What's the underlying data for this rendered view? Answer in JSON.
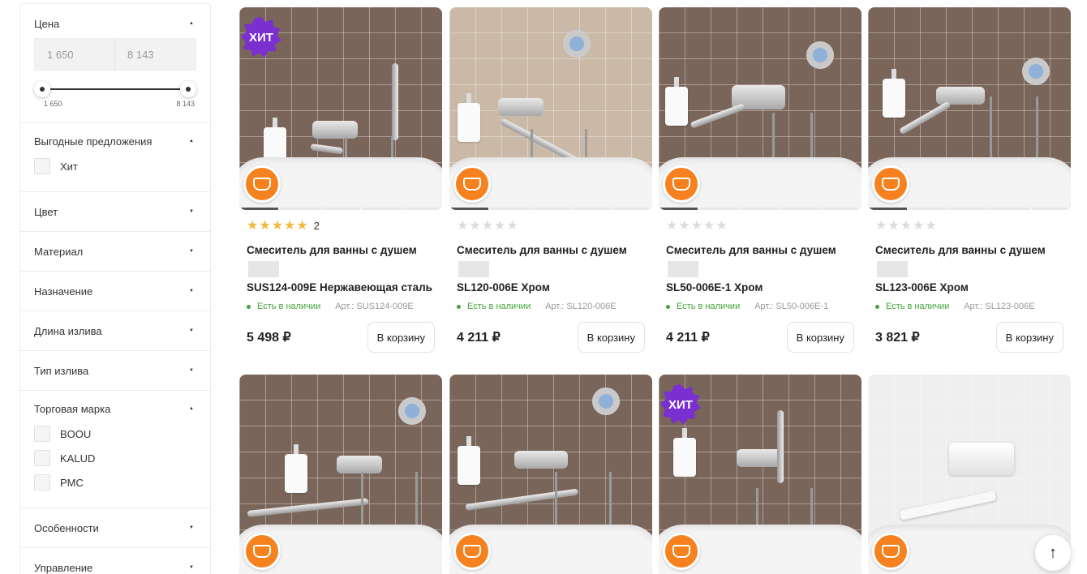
{
  "filters": {
    "price": {
      "label": "Цена",
      "min_value": "1 650",
      "max_value": "8 143",
      "slider_min_label": "1 650",
      "slider_max_label": "8 143",
      "expanded": true
    },
    "deals": {
      "label": "Выгодные предложения",
      "options": [
        "Хит"
      ],
      "expanded": true
    },
    "color": {
      "label": "Цвет"
    },
    "material": {
      "label": "Материал"
    },
    "purpose": {
      "label": "Назначение"
    },
    "spout_length": {
      "label": "Длина излива"
    },
    "spout_type": {
      "label": "Тип излива"
    },
    "brand": {
      "label": "Торговая марка",
      "options": [
        "BOOU",
        "KALUD",
        "PMC"
      ],
      "expanded": true
    },
    "features": {
      "label": "Особенности"
    },
    "control": {
      "label": "Управление"
    }
  },
  "products": [
    {
      "title_line1": "Смеситель для ванны с душем",
      "title_line2": "SUS124-009E Нержавеющая сталь",
      "stars": 5,
      "reviews": "2",
      "stock": "Есть в наличии",
      "article": "Арт.: SUS124-009E",
      "price": "5 498 ₽",
      "cart_label": "В корзину",
      "hit_badge": "ХИТ"
    },
    {
      "title_line1": "Смеситель для ванны с душем",
      "title_line2": "SL120-006E Хром",
      "stars": 0,
      "stock": "Есть в наличии",
      "article": "Арт.: SL120-006E",
      "price": "4 211 ₽",
      "cart_label": "В корзину"
    },
    {
      "title_line1": "Смеситель для ванны с душем",
      "title_line2": "SL50-006E-1 Хром",
      "stars": 0,
      "stock": "Есть в наличии",
      "article": "Арт.: SL50-006E-1",
      "price": "4 211 ₽",
      "cart_label": "В корзину"
    },
    {
      "title_line1": "Смеситель для ванны с душем",
      "title_line2": "SL123-006E Хром",
      "stars": 0,
      "stock": "Есть в наличии",
      "article": "Арт.: SL123-006E",
      "price": "3 821 ₽",
      "cart_label": "В корзину"
    },
    {
      "hit_badge": null
    },
    {
      "hit_badge": null
    },
    {
      "hit_badge": "ХИТ"
    },
    {
      "hit_badge": null
    }
  ],
  "stars": {
    "full": "★★★★★",
    "empty": "★★★★★"
  },
  "icons": {
    "chevron_up": "▲",
    "chevron_down": "▼",
    "scroll_top": "↑"
  },
  "colors": {
    "accent_star": "#f3b93c",
    "in_stock": "#43a43a",
    "hit_badge": "#7a2fd0",
    "promo_badge": "#f5821f"
  }
}
